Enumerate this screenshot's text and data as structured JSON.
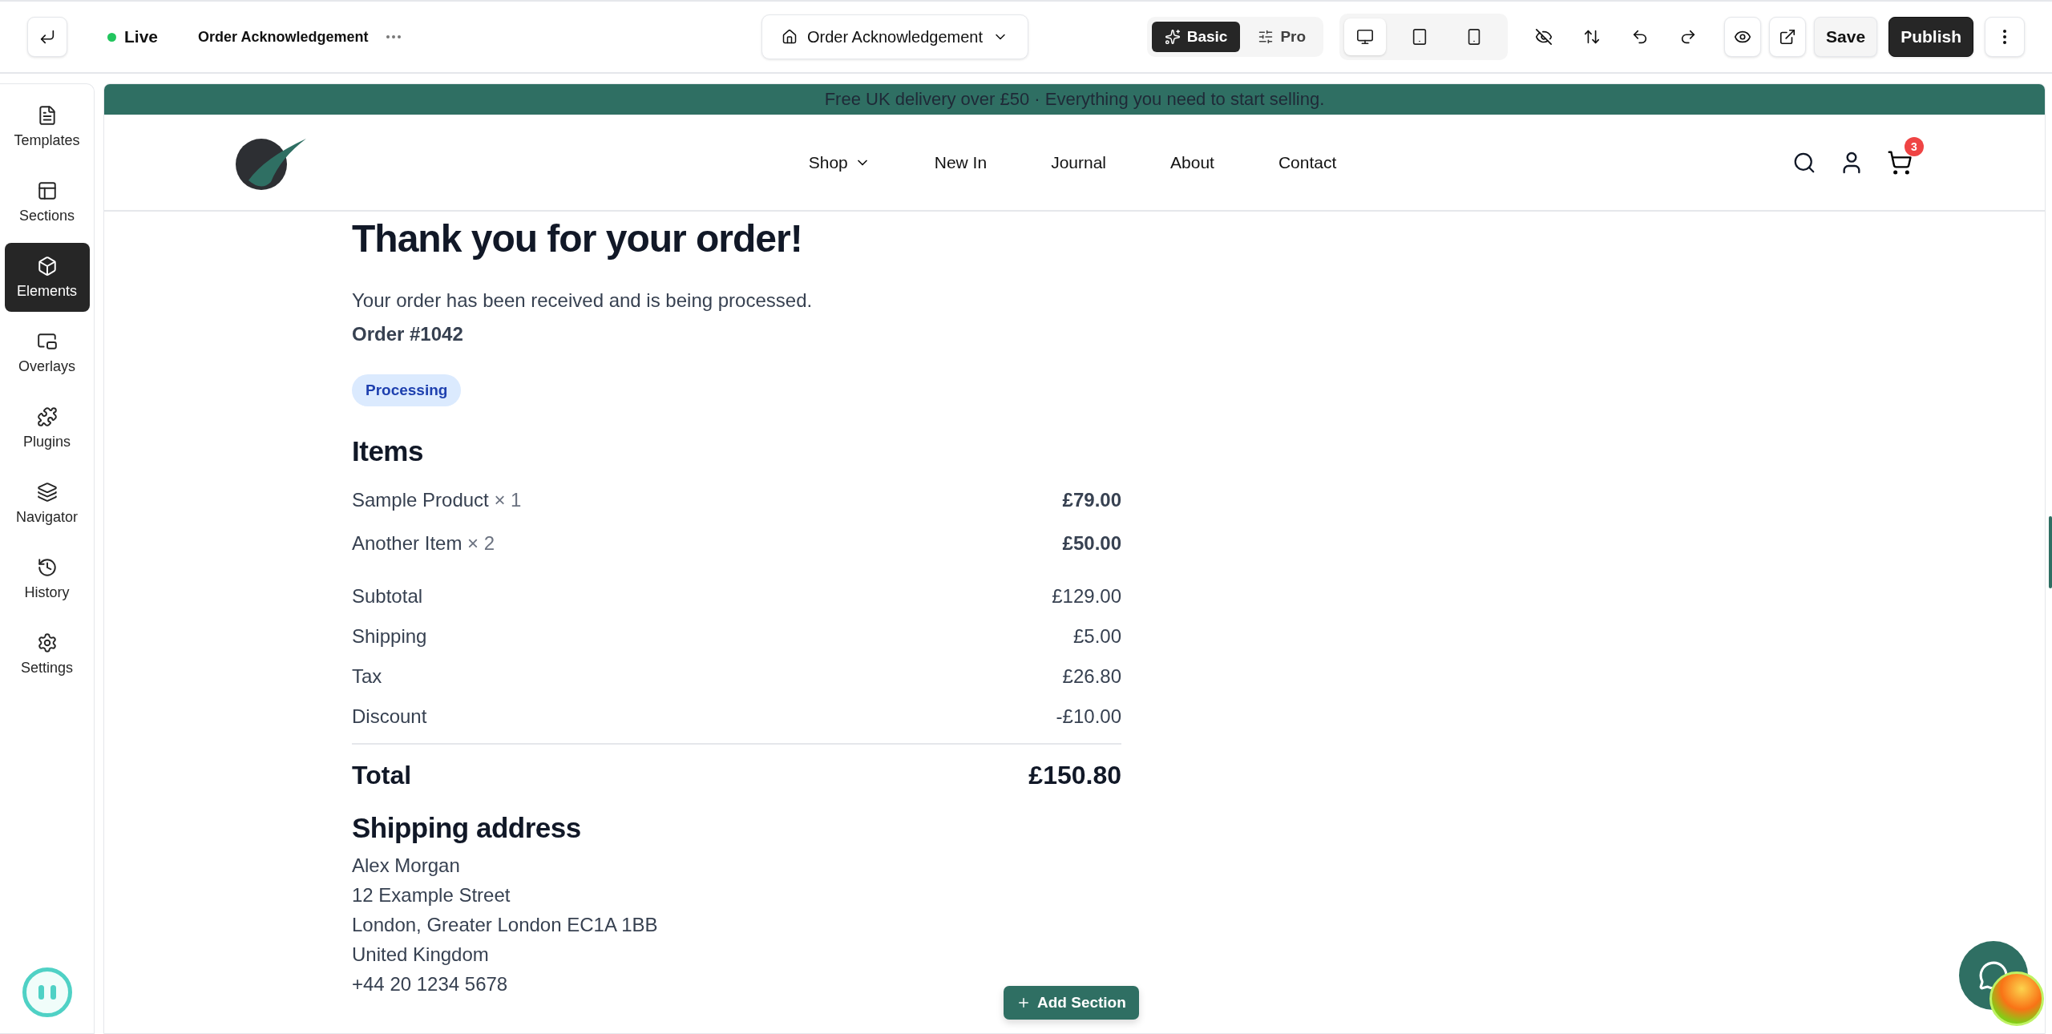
{
  "toolbar": {
    "status": {
      "label": "Live",
      "color": "#22c55e"
    },
    "page_name": "Order Acknowledgement",
    "page_selector": "Order Acknowledgement",
    "modes": [
      {
        "label": "Basic",
        "kind": "sparkles",
        "selected": true
      },
      {
        "label": "Pro",
        "kind": "sliders",
        "selected": false
      }
    ],
    "devices": [
      {
        "kind": "desktop",
        "selected": true
      },
      {
        "kind": "tablet",
        "selected": false
      },
      {
        "kind": "phone",
        "selected": false
      }
    ],
    "save": "Save",
    "publish": "Publish"
  },
  "sidebar": {
    "items": [
      {
        "label": "Templates",
        "kind": "file",
        "selected": false
      },
      {
        "label": "Sections",
        "kind": "layout",
        "selected": false
      },
      {
        "label": "Elements",
        "kind": "box",
        "selected": true
      },
      {
        "label": "Overlays",
        "kind": "overlay",
        "selected": false
      },
      {
        "label": "Plugins",
        "kind": "puzzle",
        "selected": false
      },
      {
        "label": "Navigator",
        "kind": "layers",
        "selected": false
      },
      {
        "label": "History",
        "kind": "history",
        "selected": false
      },
      {
        "label": "Settings",
        "kind": "gear",
        "selected": false
      }
    ]
  },
  "site": {
    "promo": "Free UK delivery over £50 · Everything you need to start selling.",
    "nav": [
      {
        "label": "Shop",
        "has_menu": true
      },
      {
        "label": "New In",
        "has_menu": false
      },
      {
        "label": "Journal",
        "has_menu": false
      },
      {
        "label": "About",
        "has_menu": false
      },
      {
        "label": "Contact",
        "has_menu": false
      }
    ],
    "cart_count": "3"
  },
  "order": {
    "title": "Thank you for your order!",
    "message": "Your order has been received and is being processed.",
    "order_number": "Order #1042",
    "status": "Processing",
    "items_heading": "Items",
    "items": [
      {
        "name": "Sample Product",
        "qty": "× 1",
        "price": "£79.00"
      },
      {
        "name": "Another Item",
        "qty": "× 2",
        "price": "£50.00"
      }
    ],
    "totals": [
      {
        "label": "Subtotal",
        "value": "£129.00"
      },
      {
        "label": "Shipping",
        "value": "£5.00"
      },
      {
        "label": "Tax",
        "value": "£26.80"
      },
      {
        "label": "Discount",
        "value": "-£10.00"
      }
    ],
    "total": {
      "label": "Total",
      "value": "£150.80"
    },
    "address_heading": "Shipping address",
    "address_lines": [
      "Alex Morgan",
      "12 Example Street",
      "London, Greater London EC1A 1BB",
      "United Kingdom",
      "+44 20 1234 5678"
    ]
  },
  "add_section": "Add Section"
}
